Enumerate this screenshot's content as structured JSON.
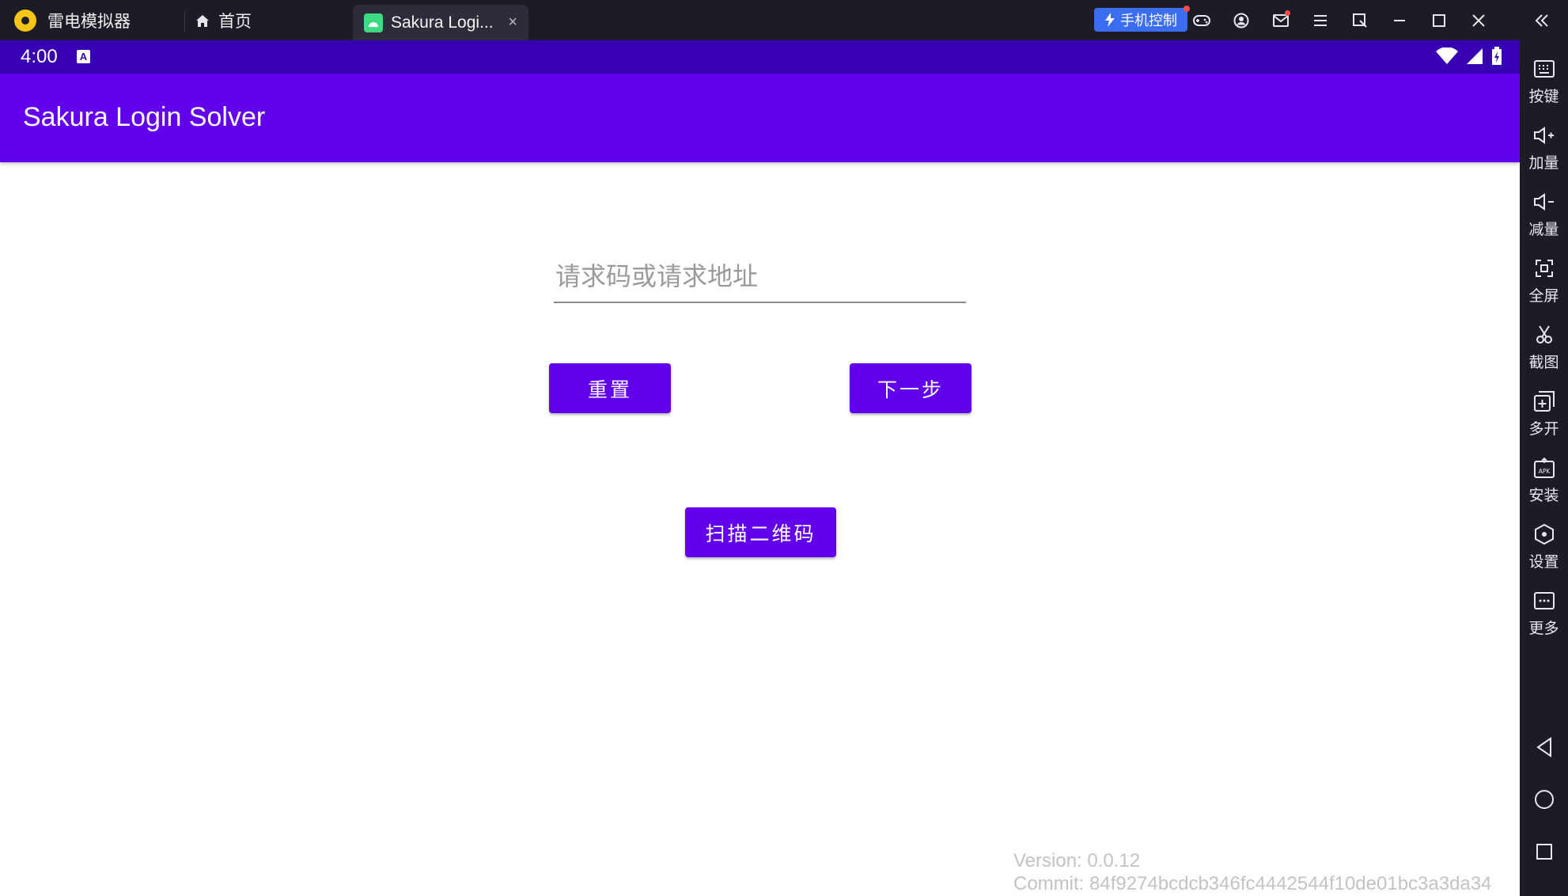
{
  "emulator": {
    "brand": "雷电模拟器",
    "home_tab": "首页",
    "app_tab": "Sakura Logi...",
    "app_tab_close": "×",
    "phone_control": "手机控制"
  },
  "status_bar": {
    "time": "4:00",
    "badge": "A"
  },
  "app": {
    "title": "Sakura Login Solver",
    "input_placeholder": "请求码或请求地址",
    "reset_button": "重置",
    "next_button": "下一步",
    "scan_button": "扫描二维码",
    "version": "Version: 0.0.12",
    "commit": "Commit: 84f9274bcdcb346fc4442544f10de01bc3a3da34"
  },
  "sidebar": {
    "items": [
      {
        "label": "按键",
        "icon": "keyboard-icon"
      },
      {
        "label": "加量",
        "icon": "volume-up-icon"
      },
      {
        "label": "减量",
        "icon": "volume-down-icon"
      },
      {
        "label": "全屏",
        "icon": "fullscreen-icon"
      },
      {
        "label": "截图",
        "icon": "screenshot-icon"
      },
      {
        "label": "多开",
        "icon": "multi-instance-icon"
      },
      {
        "label": "安装",
        "icon": "apk-install-icon"
      },
      {
        "label": "设置",
        "icon": "settings-icon"
      },
      {
        "label": "更多",
        "icon": "more-icon"
      }
    ]
  },
  "colors": {
    "primary": "#6200ee",
    "status_bar": "#3700b3",
    "emulator_bg": "#1c1c26"
  }
}
